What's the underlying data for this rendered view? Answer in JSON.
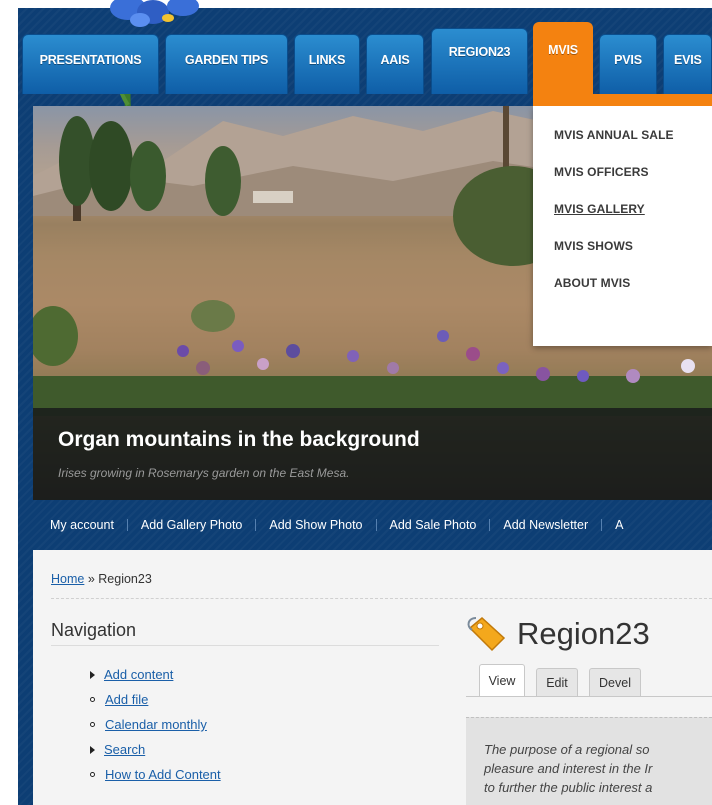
{
  "tabs": [
    {
      "label": "PRESENTATIONS"
    },
    {
      "label": "GARDEN TIPS"
    },
    {
      "label": "LINKS"
    },
    {
      "label": "AAIS"
    },
    {
      "label": "REGION23"
    },
    {
      "label": "MVIS"
    },
    {
      "label": "PVIS"
    },
    {
      "label": "EVIS"
    }
  ],
  "dropdown": {
    "items": [
      {
        "label": "MVIS ANNUAL SALE"
      },
      {
        "label": "MVIS OFFICERS"
      },
      {
        "label": "MVIS GALLERY"
      },
      {
        "label": "MVIS SHOWS"
      },
      {
        "label": "ABOUT MVIS"
      }
    ]
  },
  "hero": {
    "title": "Organ mountains in the background",
    "subtitle": "Irises growing in Rosemarys garden on the East Mesa."
  },
  "subnav": {
    "items": [
      {
        "label": "My account"
      },
      {
        "label": "Add Gallery Photo"
      },
      {
        "label": "Add Show Photo"
      },
      {
        "label": "Add Sale Photo"
      },
      {
        "label": "Add Newsletter"
      },
      {
        "label": "A"
      }
    ]
  },
  "breadcrumb": {
    "home": "Home",
    "separator": "»",
    "current": "Region23"
  },
  "navigation": {
    "title": "Navigation",
    "items": [
      {
        "label": "Add content",
        "bullet": "arrow"
      },
      {
        "label": "Add file",
        "bullet": "dot"
      },
      {
        "label": "Calendar monthly",
        "bullet": "dot"
      },
      {
        "label": "Search",
        "bullet": "arrow"
      },
      {
        "label": "How to Add Content",
        "bullet": "dot"
      }
    ]
  },
  "page": {
    "title": "Region23",
    "icon": "tag-icon",
    "tabs": [
      {
        "label": "View"
      },
      {
        "label": "Edit"
      },
      {
        "label": "Devel"
      }
    ],
    "body_lines": [
      "The purpose of a regional so",
      "pleasure and interest in the Ir",
      "to further the public interest a"
    ]
  },
  "colors": {
    "frame": "#0d3e74",
    "tab": "#1a73bd",
    "active_tab": "#f48210",
    "link": "#1a5fa8"
  }
}
